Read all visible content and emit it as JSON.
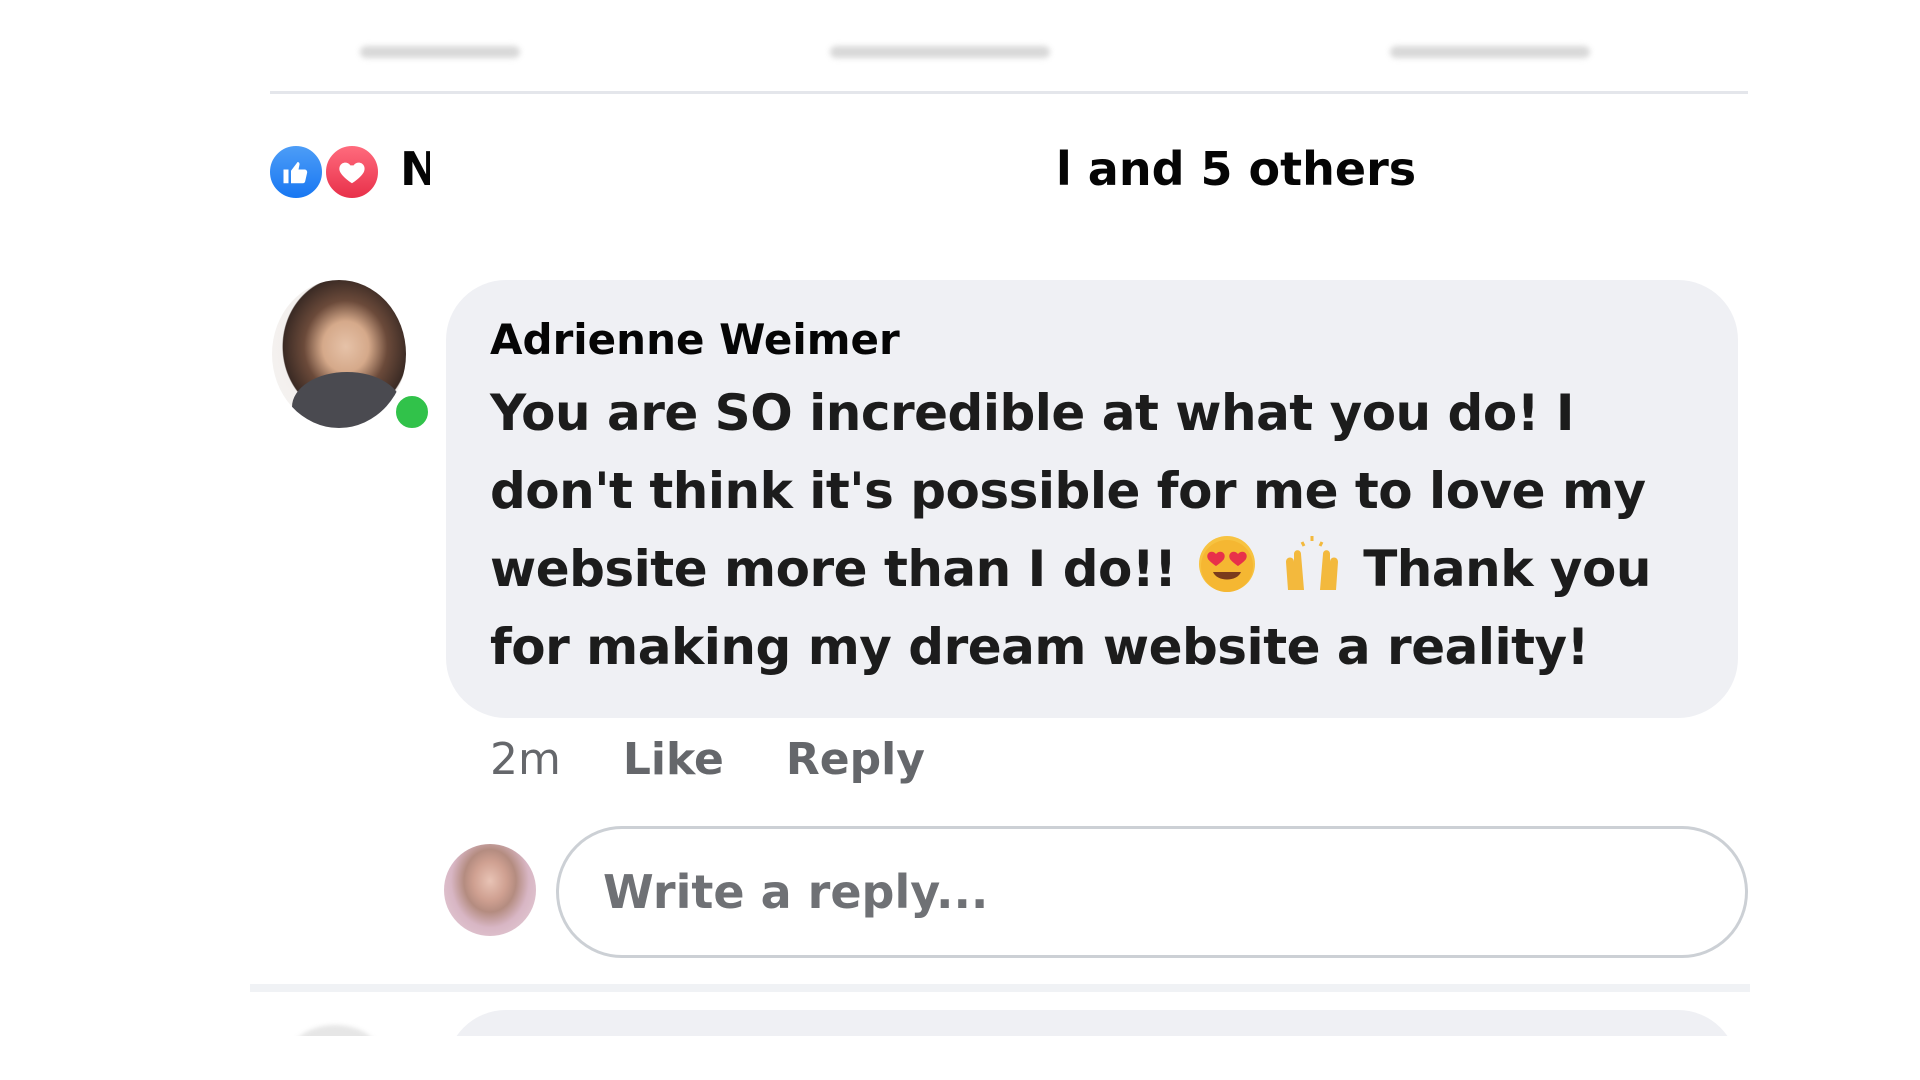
{
  "reactions": {
    "types": [
      "like-icon",
      "love-icon"
    ],
    "like_color": "#1877f2",
    "love_color": "#e8304a",
    "summary_lead": "N",
    "summary_tail": "l and 5 others"
  },
  "comment": {
    "author": "Adrienne Weimer",
    "online": true,
    "line1": "You are SO incredible at what you do! I",
    "line2": "don't think it's possible for me to love my",
    "line3_before": "website more than I do!!",
    "line3_after": "Thank you",
    "line4": "for making my dream website a reality!",
    "emojis": [
      "heart-eyes-emoji",
      "raising-hands-emoji"
    ],
    "timestamp": "2m",
    "like_label": "Like",
    "reply_label": "Reply"
  },
  "reply_box": {
    "placeholder": "Write a reply..."
  },
  "colors": {
    "bubble_bg": "#eff0f4",
    "meta_text": "#65676b",
    "online_green": "#31c24a"
  }
}
